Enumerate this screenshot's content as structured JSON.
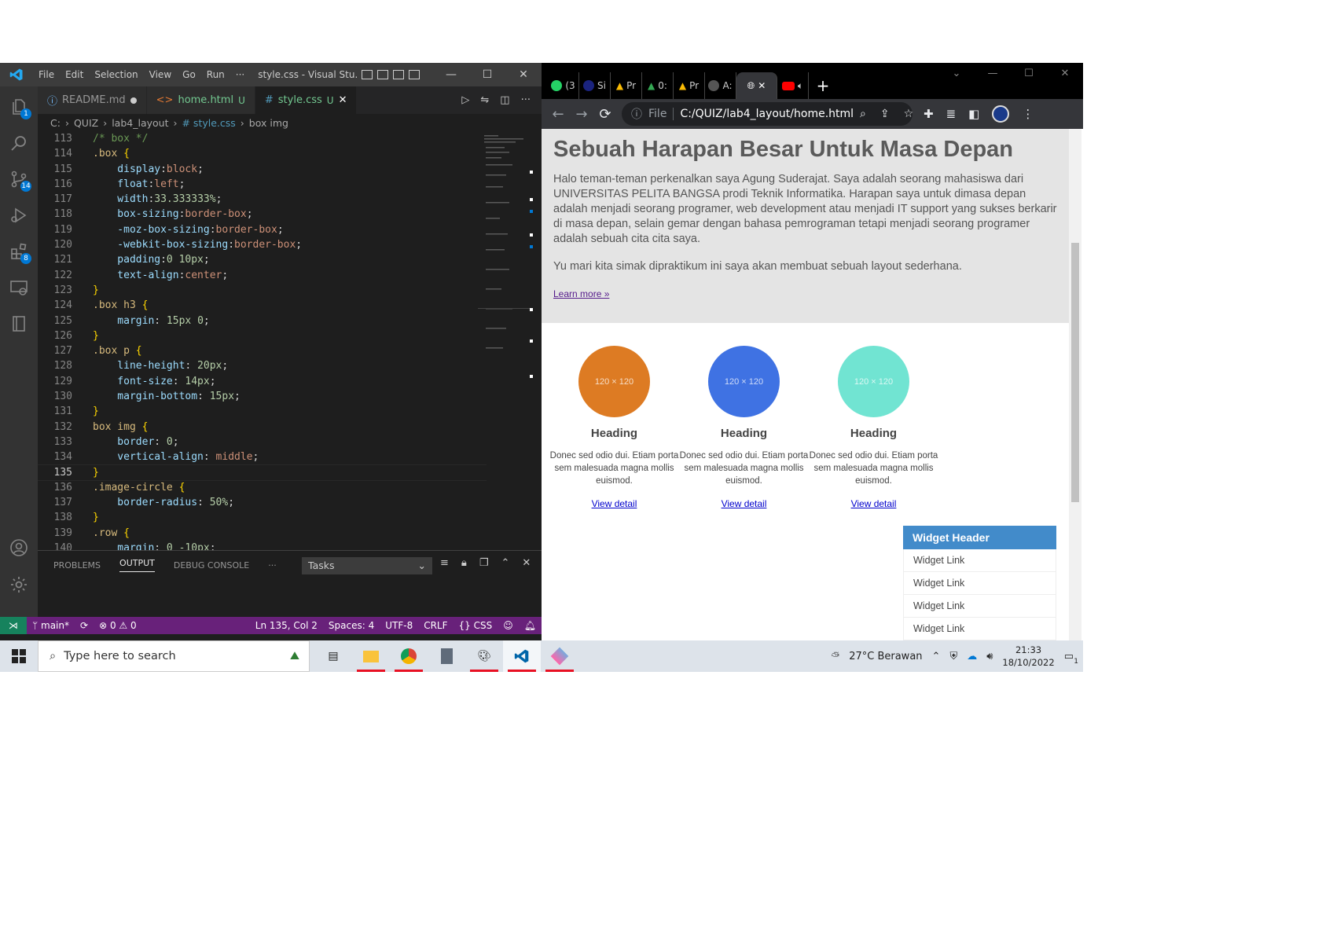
{
  "vscode": {
    "menu": [
      "File",
      "Edit",
      "Selection",
      "View",
      "Go",
      "Run",
      "···"
    ],
    "title": "style.css - Visual Stu...",
    "badges": {
      "explorer": "1",
      "source_control": "14",
      "extensions": "8"
    },
    "tabs": [
      {
        "label": "README.md",
        "marker": ""
      },
      {
        "label": "home.html",
        "marker": "U"
      },
      {
        "label": "style.css",
        "marker": "U"
      }
    ],
    "breadcrumb": [
      "C:",
      "QUIZ",
      "lab4_layout",
      "# style.css",
      "box img"
    ],
    "code": [
      {
        "n": "113",
        "text": "/* box */"
      },
      {
        "n": "114",
        "text": ".box {"
      },
      {
        "n": "115",
        "text": "    display:block;"
      },
      {
        "n": "116",
        "text": "    float:left;"
      },
      {
        "n": "117",
        "text": "    width:33.333333%;"
      },
      {
        "n": "118",
        "text": "    box-sizing:border-box;"
      },
      {
        "n": "119",
        "text": "    -moz-box-sizing:border-box;"
      },
      {
        "n": "120",
        "text": "    -webkit-box-sizing:border-box;"
      },
      {
        "n": "121",
        "text": "    padding:0 10px;"
      },
      {
        "n": "122",
        "text": "    text-align:center;"
      },
      {
        "n": "123",
        "text": "}"
      },
      {
        "n": "124",
        "text": ".box h3 {"
      },
      {
        "n": "125",
        "text": "    margin: 15px 0;"
      },
      {
        "n": "126",
        "text": "}"
      },
      {
        "n": "127",
        "text": ".box p {"
      },
      {
        "n": "128",
        "text": "    line-height: 20px;"
      },
      {
        "n": "129",
        "text": "    font-size: 14px;"
      },
      {
        "n": "130",
        "text": "    margin-bottom: 15px;"
      },
      {
        "n": "131",
        "text": "}"
      },
      {
        "n": "132",
        "text": "box img {"
      },
      {
        "n": "133",
        "text": "    border: 0;"
      },
      {
        "n": "134",
        "text": "    vertical-align: middle;"
      },
      {
        "n": "135",
        "text": "}"
      },
      {
        "n": "136",
        "text": ".image-circle {"
      },
      {
        "n": "137",
        "text": "    border-radius: 50%;"
      },
      {
        "n": "138",
        "text": "}"
      },
      {
        "n": "139",
        "text": ".row {"
      },
      {
        "n": "140",
        "text": "    margin: 0 -10px;"
      }
    ],
    "current_line": "135",
    "panel_tabs": [
      "PROBLEMS",
      "OUTPUT",
      "DEBUG CONSOLE",
      "···"
    ],
    "tasks_select": "Tasks",
    "status": {
      "branch": "main*",
      "errors": "0",
      "warnings": "0",
      "position": "Ln 135, Col 2",
      "spaces": "Spaces: 4",
      "encoding": "UTF-8",
      "eol": "CRLF",
      "language": "CSS"
    }
  },
  "chrome": {
    "tabs": [
      "(3",
      "Si",
      "Pr",
      "0:",
      "Pr",
      "A:"
    ],
    "omnibox_scheme": "File",
    "url": "C:/QUIZ/lab4_layout/home.html"
  },
  "page": {
    "heading": "Sebuah Harapan Besar Untuk Masa Depan",
    "para1": "Halo teman-teman perkenalkan saya Agung Suderajat. Saya adalah seorang mahasiswa dari UNIVERSITAS PELITA BANGSA prodi Teknik Informatika. Harapan saya untuk dimasa depan adalah menjadi seorang programer, web development atau menjadi IT support yang sukses berkarir di masa depan, selain gemar dengan bahasa pemrograman tetapi menjadi seorang programer adalah sebuah cita cita saya.",
    "para2": "Yu mari kita simak dipraktikum ini saya akan membuat sebuah layout sederhana.",
    "learn_more": "Learn more »",
    "boxes": [
      {
        "img": "120 × 120",
        "color": "#dd7b23",
        "heading": "Heading",
        "text": "Donec sed odio dui. Etiam porta sem malesuada magna mollis euismod.",
        "link": "View detail"
      },
      {
        "img": "120 × 120",
        "color": "#3f72e3",
        "heading": "Heading",
        "text": "Donec sed odio dui. Etiam porta sem malesuada magna mollis euismod.",
        "link": "View detail"
      },
      {
        "img": "120 × 120",
        "color": "#71e4d2",
        "heading": "Heading",
        "text": "Donec sed odio dui. Etiam porta sem malesuada magna mollis euismod.",
        "link": "View detail"
      }
    ],
    "widget_header": "Widget Header",
    "widget_links": [
      "Widget Link",
      "Widget Link",
      "Widget Link",
      "Widget Link"
    ]
  },
  "taskbar": {
    "search_placeholder": "Type here to search",
    "weather": "27°C  Berawan",
    "time": "21:33",
    "date": "18/10/2022",
    "notification_count": "1"
  }
}
